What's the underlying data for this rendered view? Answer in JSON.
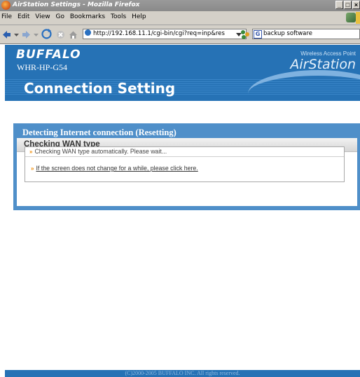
{
  "window": {
    "title": "AirStation Settings - Mozilla Firefox"
  },
  "menu": [
    "File",
    "Edit",
    "View",
    "Go",
    "Bookmarks",
    "Tools",
    "Help"
  ],
  "address_bar": {
    "url": "http://192.168.11.1/cgi-bin/cgi?req=inp&res"
  },
  "search_bar": {
    "value": "backup software"
  },
  "header": {
    "brand": "BUFFALO",
    "model": "WHR-HP-G54",
    "subtitle": "Wireless Access Point",
    "product": "AirStation",
    "page_title": "Connection Setting"
  },
  "panel": {
    "heading": "Detecting Internet connection (Resetting)",
    "subheading": "Checking WAN type",
    "status": "Checking WAN type automatically. Please wait...",
    "link": "If the screen does not change for a while, please click here."
  },
  "footer": {
    "copyright": "(C)2000-2005 BUFFALO INC. All rights reserved."
  },
  "colors": {
    "brand_blue": "#2672b5",
    "panel_blue": "#4f8fc9",
    "arrow_orange": "#f08a00"
  }
}
